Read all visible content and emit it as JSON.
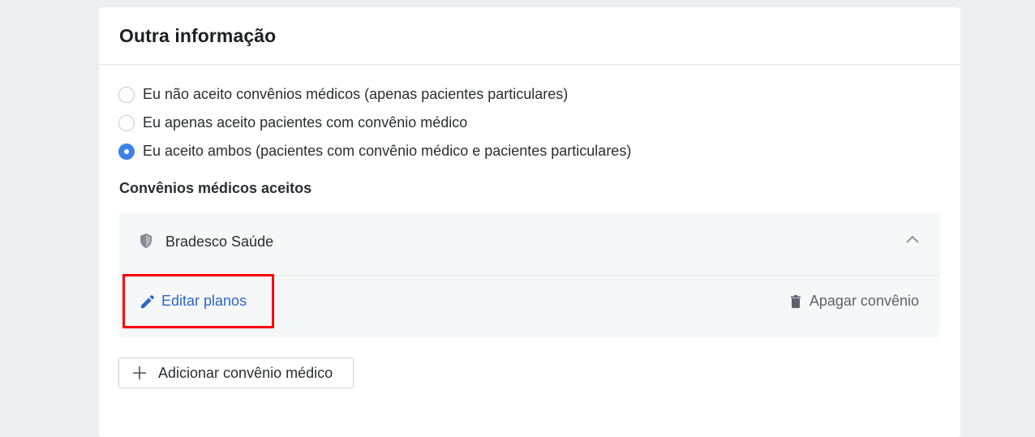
{
  "card": {
    "title": "Outra informação"
  },
  "insurance_options": [
    {
      "label": "Eu não aceito convênios médicos (apenas pacientes particulares)",
      "checked": false
    },
    {
      "label": "Eu apenas aceito pacientes com convênio médico",
      "checked": false
    },
    {
      "label": "Eu aceito ambos (pacientes com convênio médico e pacientes particulares)",
      "checked": true
    }
  ],
  "accepted": {
    "section_title": "Convênios médicos aceitos",
    "items": [
      {
        "name": "Bradesco Saúde",
        "icon": "shield-icon",
        "expanded": true,
        "edit_label": "Editar planos",
        "delete_label": "Apagar convênio"
      }
    ]
  },
  "add_button": {
    "label": "Adicionar convênio médico",
    "icon": "plus-icon"
  },
  "colors": {
    "accent": "#3d82e6",
    "link": "#2d66c8",
    "highlight": "#ff0000"
  }
}
